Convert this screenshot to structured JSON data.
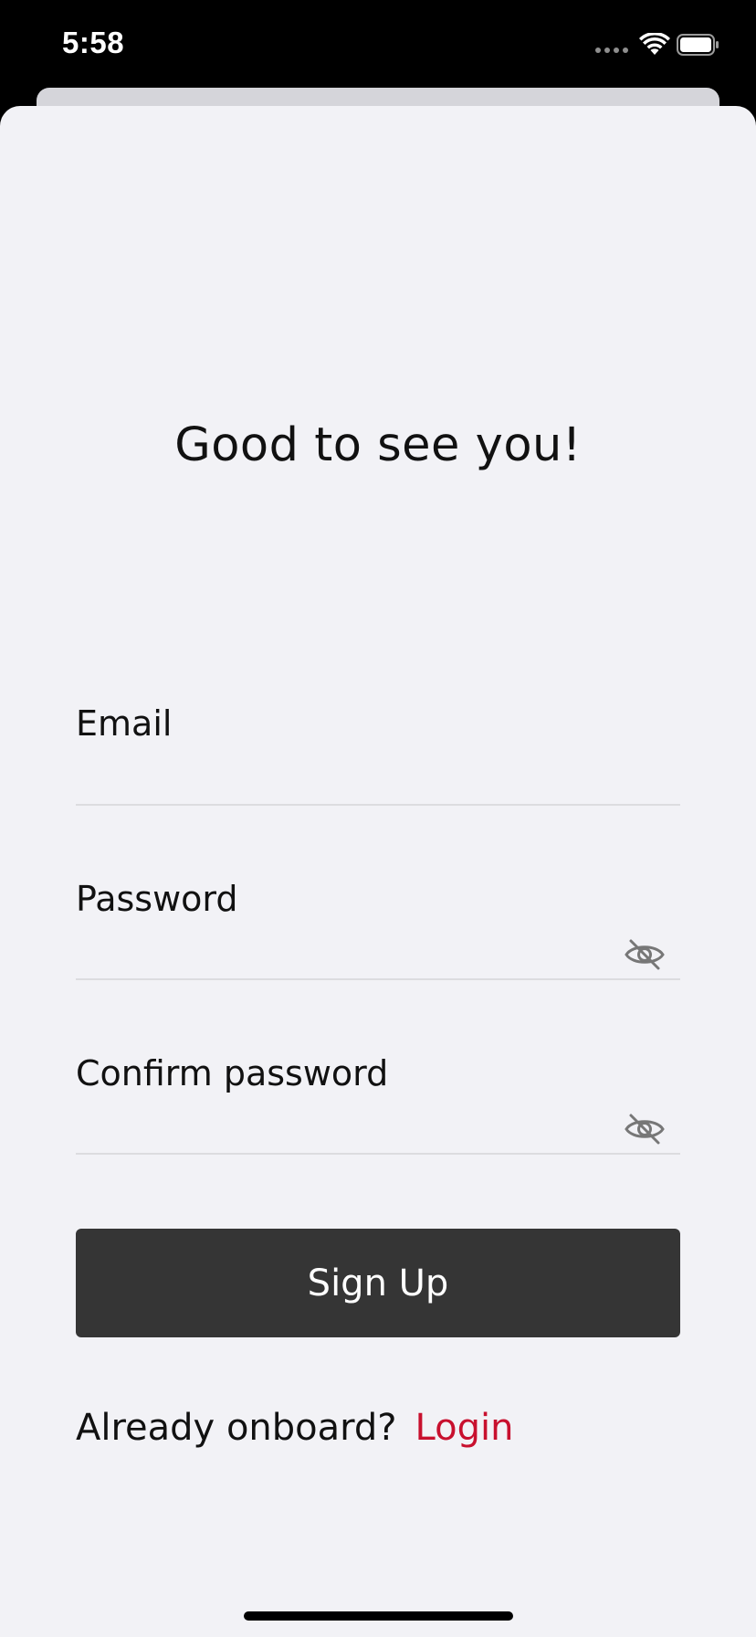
{
  "status_bar": {
    "time": "5:58",
    "icons": [
      "signal-dots-icon",
      "wifi-icon",
      "battery-icon"
    ]
  },
  "greeting": "Good to see you!",
  "form": {
    "email": {
      "label": "Email",
      "value": "",
      "placeholder": ""
    },
    "password": {
      "label": "Password",
      "value": "",
      "placeholder": "",
      "toggle_icon": "eye-slash-icon"
    },
    "confirm_password": {
      "label": "Confirm password",
      "value": "",
      "placeholder": "",
      "toggle_icon": "eye-slash-icon"
    }
  },
  "signup_button": {
    "label": "Sign Up"
  },
  "footer": {
    "prompt": "Already onboard?",
    "login_link": "Login"
  },
  "colors": {
    "background": "#f2f2f6",
    "button": "#353535",
    "link": "#c8102e",
    "status_bar": "#000000"
  }
}
